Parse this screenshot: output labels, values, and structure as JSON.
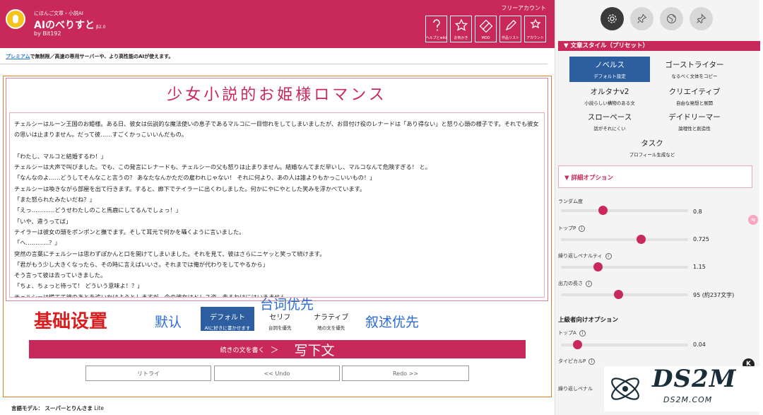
{
  "header": {
    "brand_sub": "にほんご文章・小説AI",
    "brand_title": "AIのべりすと",
    "brand_version": "β2.0",
    "brand_by": "by Bit192",
    "account_label": "フリーアカウント",
    "toolbar": [
      {
        "icon": "help-icon",
        "label": "ヘルプとwiki"
      },
      {
        "icon": "star-icon",
        "label": "お気かき"
      },
      {
        "icon": "mod-icon",
        "label": "MOD"
      },
      {
        "icon": "pen-icon",
        "label": "作品リスト"
      },
      {
        "icon": "account-icon",
        "label": "アカウント"
      }
    ]
  },
  "premium": {
    "link": "プレミアム",
    "text": "で無制限／高速の専用サーバーや、より高性能のAIが使えます。"
  },
  "story": {
    "title": "少女小説的お姫様ロマンス",
    "paragraphs": [
      "チェルシーはルーン王国のお姫様。ある日、彼女は伝説的な魔法使いの息子であるマルコに一目惚れをしてしまいましたが、お目付け役のレナードは「あり得ない」と怒り心頭の様子です。それでも彼女の思いは止まりません。だって彼……すごくかっこいいんだもの。",
      "",
      "「わたし、マルコと結婚するわ！」",
      "チェルシーは大声で叫びました。でも、この発言にレナードも、チェルシーの父も怒りは止まりません。結婚なんてまだ早いし、マルコなんて危険すぎる！ と。",
      "「なんなのよ……どうしてそんなこと言うの？ あなたなんかただの雇われじゃない！ それに何より、あの人は誰よりもかっこいいもの！」",
      "チェルシーは喚きながら部屋を出て行きます。すると、廊下でテイラーに出くわしました。何かにやにやとした笑みを浮かべています。",
      "「また怒られたみたいだね？」",
      "「えっ…………どうせわたしのこと馬鹿にしてるんでしょっ！」",
      "「いや、違うってば」",
      "テイラーは彼女の頭をポンポンと撫でます。そして耳元で何かを囁くように言いました。",
      "「へ…………？」",
      "突然の言葉にチェルシーは思わずぽかんと口を開けてしまいました。それを見て、彼はさらにニヤッと笑って続けます。",
      "「君がもう少し大きくなったら、その時に言えばいいさ。それまでは俺が代わりをしてやるから」",
      "そう言って彼は去っていきました。",
      "「ちょ、ちょっと待って！ どういう意味よ！？」",
      "チェルシーは慌てて彼のあとを追いかけようとしますが、今の彼女はドレス姿。走るわけにはいきません。"
    ]
  },
  "annotations": {
    "basic_settings": "基础设置",
    "default_cn": "默认",
    "dialogue_first": "台词优先",
    "narration_first": "叙述优先",
    "write_next": "写下文"
  },
  "modes": {
    "default": {
      "label": "デフォルト",
      "sub": "AIに好きに書かせます"
    },
    "serif": {
      "label": "セリフ",
      "sub": "台詞を優先"
    },
    "narrative": {
      "label": "ナラティブ",
      "sub": "地の文を優先"
    }
  },
  "actions": {
    "continue": "続きの文を書く",
    "arrow": "＞",
    "retry": "リトライ",
    "undo": "<< Undo",
    "redo": "Redo >>"
  },
  "model": {
    "label": "言語モデル：",
    "value": "スーパーとりんさま",
    "suffix": "Lite"
  },
  "sidebar": {
    "tabs": [
      "gear-icon",
      "pin-icon",
      "globe-icon",
      "pushpin-icon"
    ],
    "preset_header": "▼ 文章スタイル（プリセット）",
    "presets": [
      {
        "label": "ノベルス",
        "sub": "デフォルト設定",
        "selected": true
      },
      {
        "label": "ゴーストライター",
        "sub": "なるべく文体をコピー"
      },
      {
        "label": "オルタナv2",
        "sub": "小説らしい構物のある文"
      },
      {
        "label": "クリエイティブ",
        "sub": "自由な発想と展開"
      },
      {
        "label": "スローペース",
        "sub": "話がそれにくい"
      },
      {
        "label": "デイドリーマー",
        "sub": "論理性と創造性"
      },
      {
        "label": "タスク",
        "sub": "プロフィール生成など"
      }
    ],
    "detail_header": "▼ 詳細オプション",
    "options": [
      {
        "label": "ランダム度",
        "info": false,
        "value": "0.8",
        "fraction": 0.33
      },
      {
        "label": "トップP",
        "info": true,
        "value": "0.725",
        "fraction": 0.63
      },
      {
        "label": "繰り返しペナルティ",
        "info": true,
        "value": "1.15",
        "fraction": 0.29
      },
      {
        "label": "出力の長さ",
        "info": true,
        "value": "95 (約237文字)",
        "fraction": 0.45
      }
    ],
    "advanced_header": "上級者向けオプション",
    "advanced": [
      {
        "label": "トップA",
        "info": true,
        "value": "0.04",
        "fraction": 0.13
      },
      {
        "label": "タイピカルP",
        "info": true,
        "value": "",
        "fraction": 0.0
      },
      {
        "label": "繰り返しペナル",
        "info": false,
        "value": "",
        "fraction": 0.0
      }
    ]
  },
  "watermark": {
    "brand": "DS2M",
    "url": "DS2M.COM"
  },
  "colors": {
    "brand": "#c8285a",
    "selected": "#2d5fa0",
    "annotation_red": "#d81e1e",
    "annotation_blue": "#2b6cd9"
  }
}
